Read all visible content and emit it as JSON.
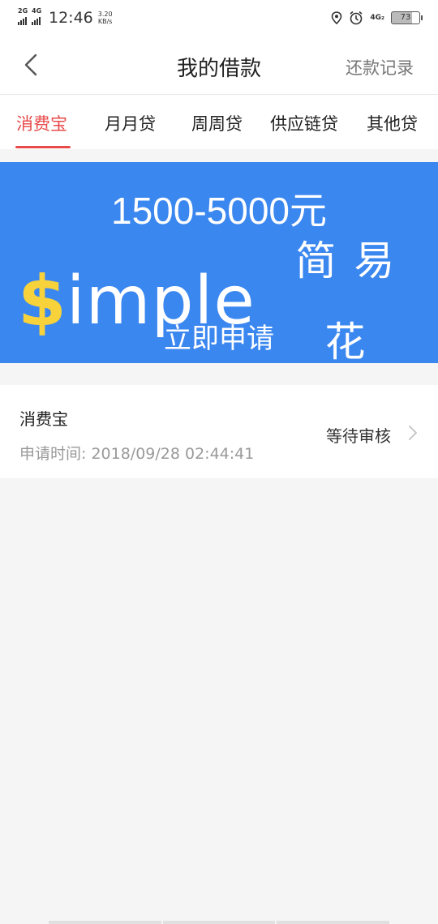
{
  "status_bar": {
    "network1": "2G",
    "network2": "4G",
    "time": "12:46",
    "speed_value": "3.20",
    "speed_unit": "KB/s",
    "network3": "4G₂",
    "battery": "73",
    "icons": [
      "location-icon",
      "alarm-icon"
    ]
  },
  "navbar": {
    "title": "我的借款",
    "right_link": "还款记录",
    "back_icon": "chevron-left-icon"
  },
  "tabs": [
    {
      "label": "消费宝",
      "active": true
    },
    {
      "label": "月月贷",
      "active": false
    },
    {
      "label": "周周贷",
      "active": false
    },
    {
      "label": "供应链贷",
      "active": false
    },
    {
      "label": "其他贷",
      "active": false
    }
  ],
  "banner": {
    "amount": "1500-5000元",
    "brand_dollar": "$",
    "brand_text": "imple",
    "brand_cn": "简易花",
    "cta": "立即申请",
    "colors": {
      "background": "#3b87f0",
      "dollar": "#f7d23b"
    }
  },
  "loan": {
    "name": "消费宝",
    "apply_time": "申请时间: 2018/09/28 02:44:41",
    "status": "等待审核"
  },
  "colors": {
    "accent": "#e84a4a"
  }
}
